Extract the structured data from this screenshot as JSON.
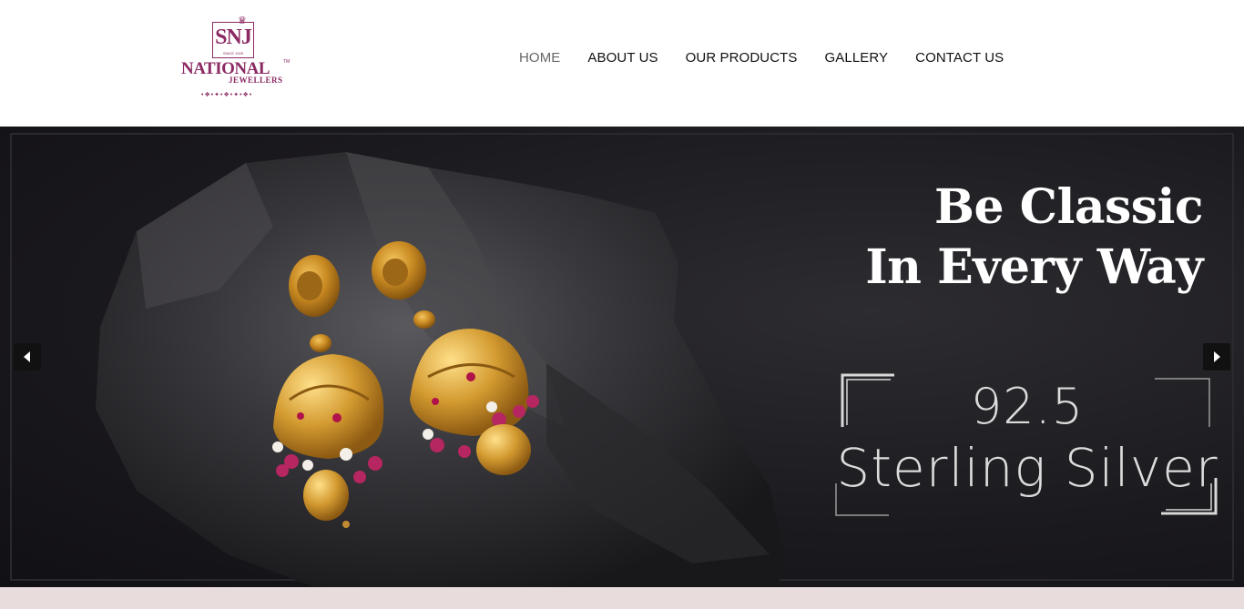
{
  "brand": {
    "monogram": "SNJ",
    "since": "SINCE 1929",
    "name": "NATIONAL",
    "subtitle": "JEWELLERS",
    "trademark": "TM",
    "accent_color": "#8b2a63"
  },
  "nav": {
    "items": [
      {
        "label": "HOME",
        "active": true
      },
      {
        "label": "ABOUT US",
        "active": false
      },
      {
        "label": "OUR PRODUCTS",
        "active": false
      },
      {
        "label": "GALLERY",
        "active": false
      },
      {
        "label": "CONTACT US",
        "active": false
      }
    ]
  },
  "hero": {
    "headline_line1": "Be Classic",
    "headline_line2": "In Every Way",
    "purity": "92.5",
    "material": "Sterling Silver",
    "image_subject": "gold temple jhumka earrings on dark rock",
    "prev_icon": "caret-left-icon",
    "next_icon": "caret-right-icon"
  },
  "colors": {
    "nav_text": "#111111",
    "nav_active": "#666666",
    "hero_bg": "#1b1a1e",
    "strip_bg": "#e9dcdc"
  }
}
